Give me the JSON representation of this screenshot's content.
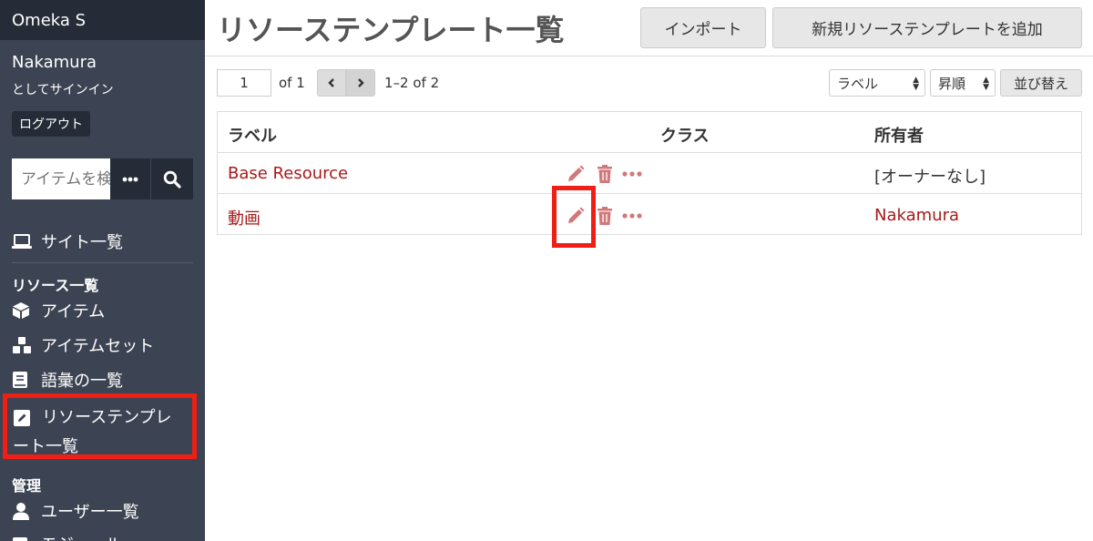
{
  "sidebar": {
    "brand": "Omeka S",
    "user_name": "Nakamura",
    "signed_in_as": "としてサインイン",
    "logout_label": "ログアウト",
    "search_placeholder": "アイテムを検索",
    "search_options": "•••",
    "sites_label": "サイト一覧",
    "resources_heading": "リソース一覧",
    "items_label": "アイテム",
    "item_sets_label": "アイテムセット",
    "vocabularies_label": "語彙の一覧",
    "resource_templates_label_line1": "リソーステンプレ",
    "resource_templates_label_line2": "ート一覧",
    "admin_heading": "管理",
    "users_label": "ユーザー一覧",
    "modules_label": "モジュール"
  },
  "header": {
    "title": "リソーステンプレート一覧",
    "import_label": "インポート",
    "add_label": "新規リソーステンプレートを追加"
  },
  "pagination": {
    "page": "1",
    "of_text": "of 1",
    "range_text": "1–2 of 2"
  },
  "sorting": {
    "sort_by": "ラベル",
    "order": "昇順",
    "sort_button": "並び替え"
  },
  "table": {
    "headers": {
      "label": "ラベル",
      "class": "クラス",
      "owner": "所有者"
    },
    "rows": [
      {
        "label": "Base Resource",
        "class": "",
        "owner": "[オーナーなし]",
        "owner_is_link": false
      },
      {
        "label": "動画",
        "class": "",
        "owner": "Nakamura",
        "owner_is_link": true
      }
    ]
  },
  "colors": {
    "sidebar_bg": "#3c4352",
    "sidebar_dark": "#262c37",
    "link": "#a91919",
    "highlight": "#f01e14",
    "action_icon": "#d0787b"
  }
}
